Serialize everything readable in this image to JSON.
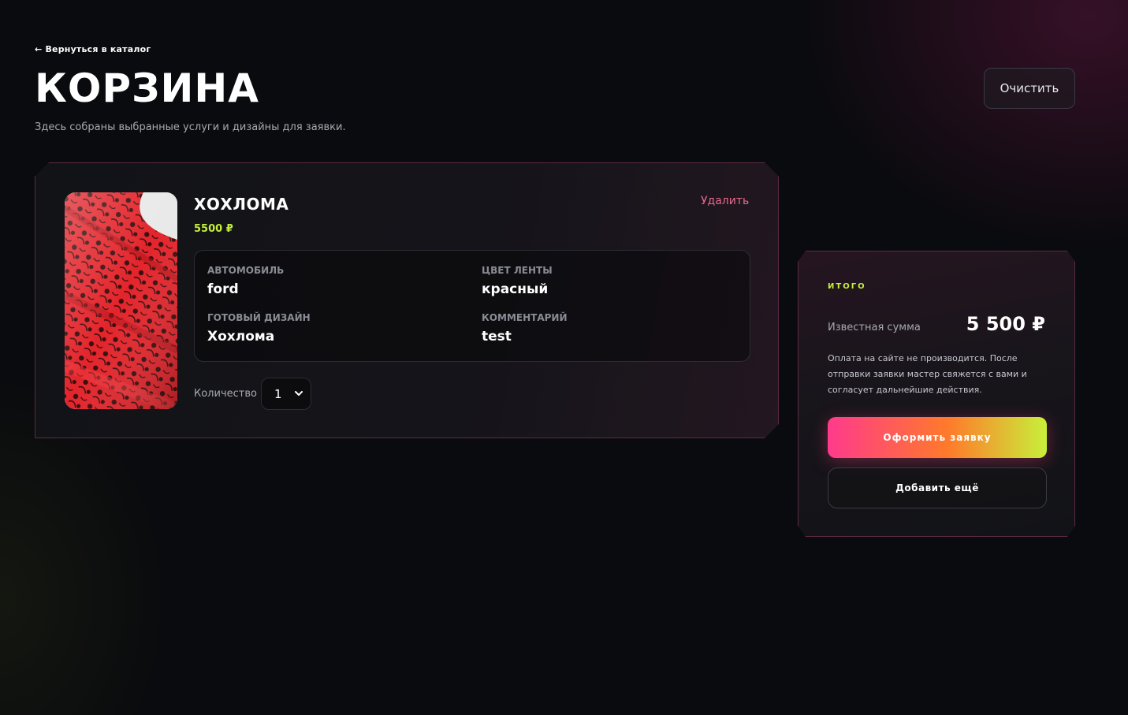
{
  "nav": {
    "back_label": "← Вернуться в каталог"
  },
  "header": {
    "title": "КОРЗИНА",
    "subtitle": "Здесь собраны выбранные услуги и дизайны для заявки.",
    "clear_label": "Очистить"
  },
  "cart_item": {
    "name": "ХОХЛОМА",
    "price": "5500 ₽",
    "delete_label": "Удалить",
    "image_icon": "khokhloma-ribbon-photo",
    "details": [
      {
        "label": "Автомобиль",
        "value": "ford"
      },
      {
        "label": "Цвет ленты",
        "value": "красный"
      },
      {
        "label": "Готовый дизайн",
        "value": "Хохлома"
      },
      {
        "label": "Комментарий",
        "value": "test"
      }
    ],
    "quantity_label": "Количество",
    "quantity_value": "1"
  },
  "summary": {
    "heading": "ИТОГО",
    "known_sum_label": "Известная сумма",
    "total": "5 500 ₽",
    "note": "Оплата на сайте не производится. После отправки заявки мастер свяжется с вами и согласует дальнейшие действия.",
    "submit_label": "Оформить заявку",
    "add_more_label": "Добавить ещё"
  },
  "colors": {
    "accent_lime": "#c6ef3a",
    "accent_pink": "#ff3a8c",
    "delete_pink": "#e86a8c",
    "background": "#0a0b0e"
  }
}
